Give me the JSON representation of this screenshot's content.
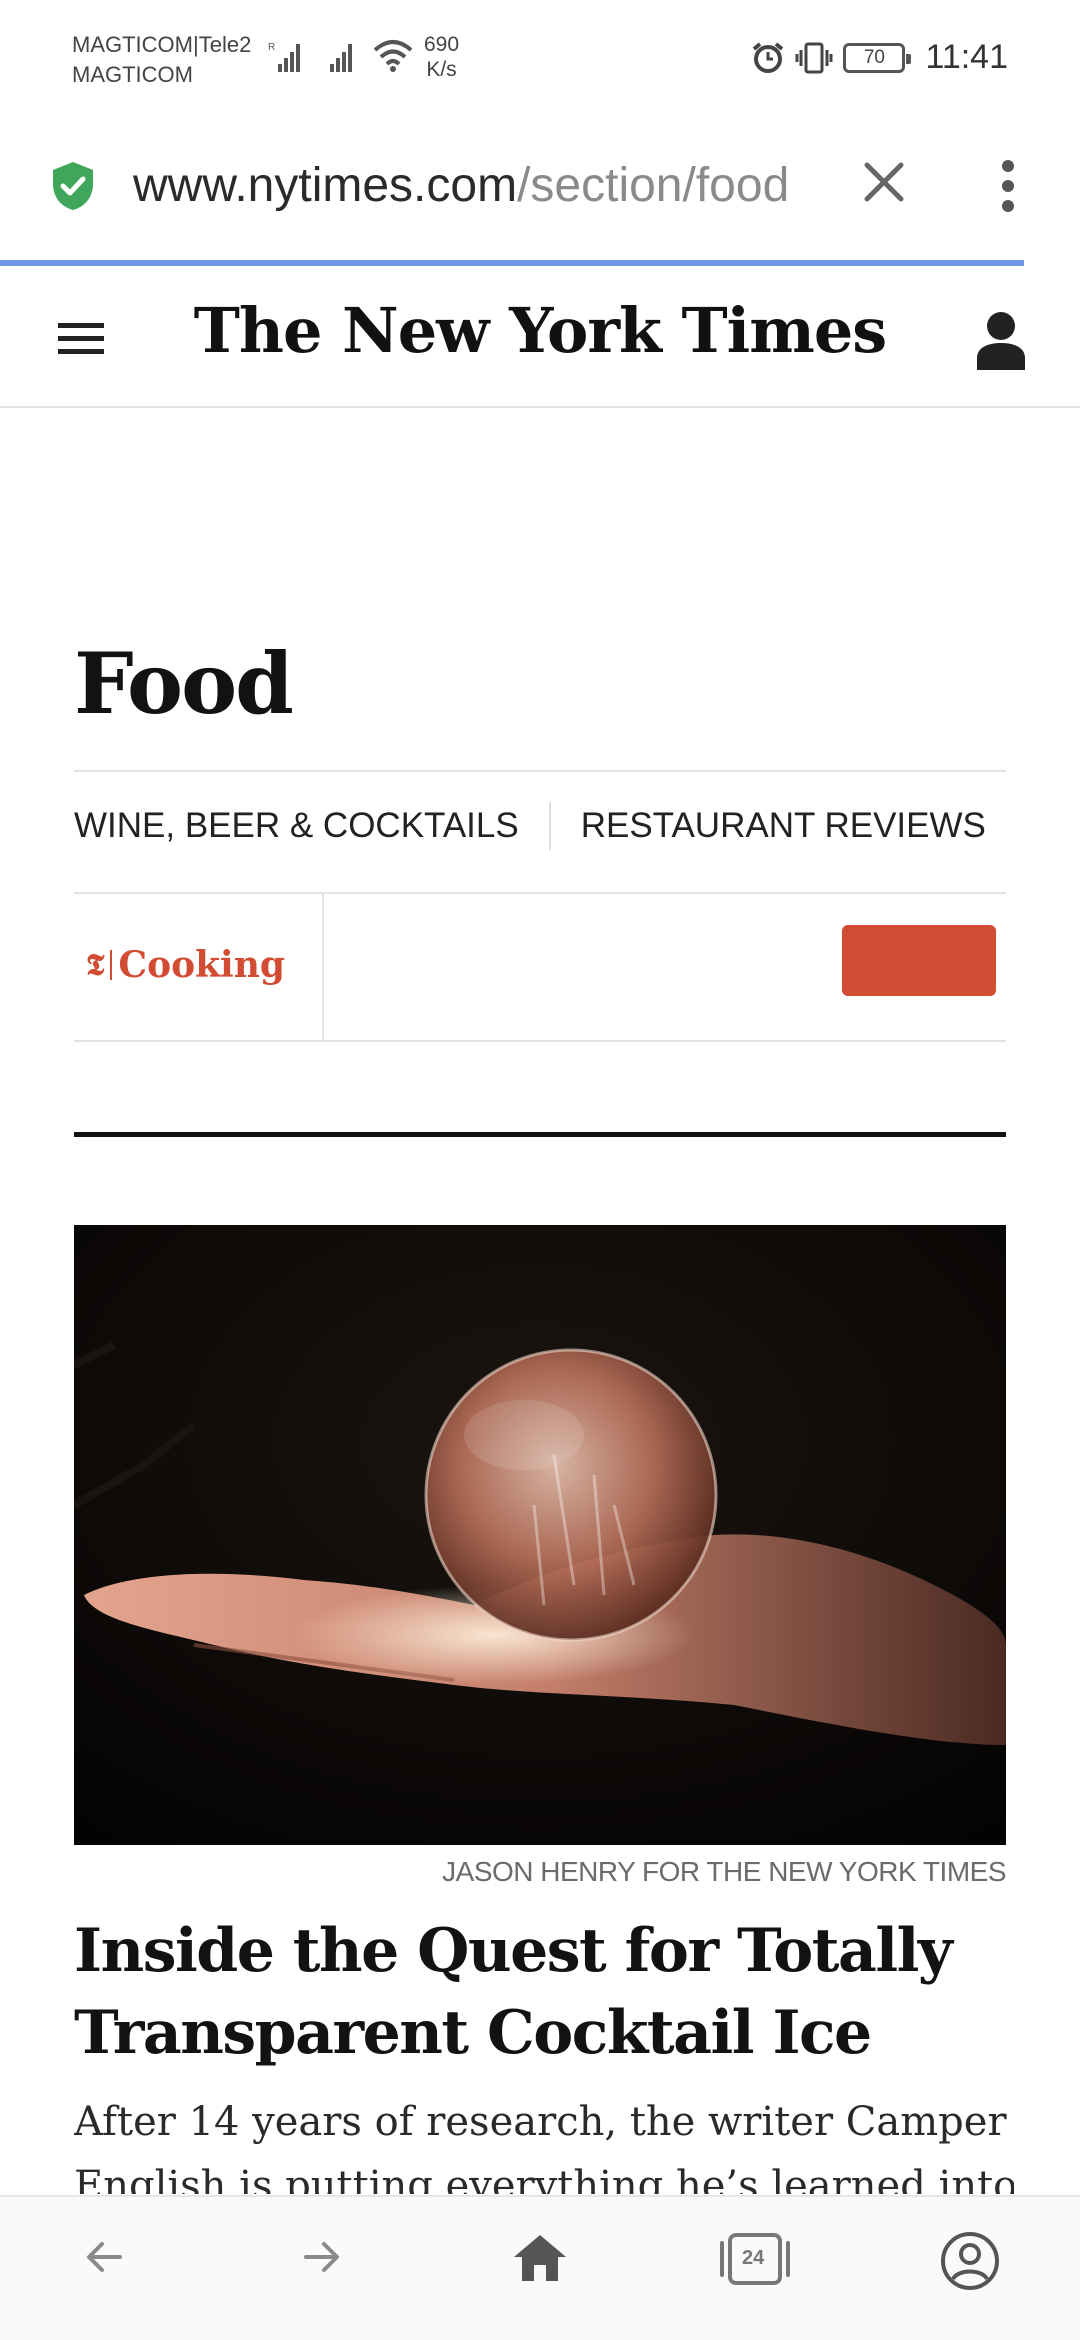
{
  "status_bar": {
    "carrier_line1": "MAGTICOM|Tele2",
    "carrier_line2": "MAGTICOM",
    "speed_value": "690",
    "speed_unit": "K/s",
    "battery": "70",
    "time": "11:41"
  },
  "browser": {
    "url_host": "www.nytimes.com",
    "url_path": "/section/food",
    "tabs_count": "24",
    "progress_color": "#6d96e6"
  },
  "nyt": {
    "masthead": "The New York Times"
  },
  "section": {
    "title": "Food",
    "subnav": [
      "WINE, BEER & COCKTAILS",
      "RESTAURANT REVIEWS"
    ],
    "cooking_t": "𝕿",
    "cooking_word": "Cooking",
    "accent_color": "#d24b33"
  },
  "article": {
    "photo_credit": "JASON HENRY FOR THE NEW YORK TIMES",
    "headline": "Inside the Quest for Totally Transparent Cocktail Ice",
    "summary_line1": "After 14 years of research, the writer Camper",
    "summary_line2": "English is putting everything he’s learned into"
  },
  "icons": {
    "security": "shield-check-icon",
    "close": "close-icon",
    "menu": "more-vert-icon",
    "nav_menu": "hamburger-icon",
    "account": "user-icon",
    "back": "arrow-back-icon",
    "forward": "arrow-forward-icon",
    "home": "home-icon",
    "tabs": "tabs-icon",
    "profile": "profile-icon"
  }
}
